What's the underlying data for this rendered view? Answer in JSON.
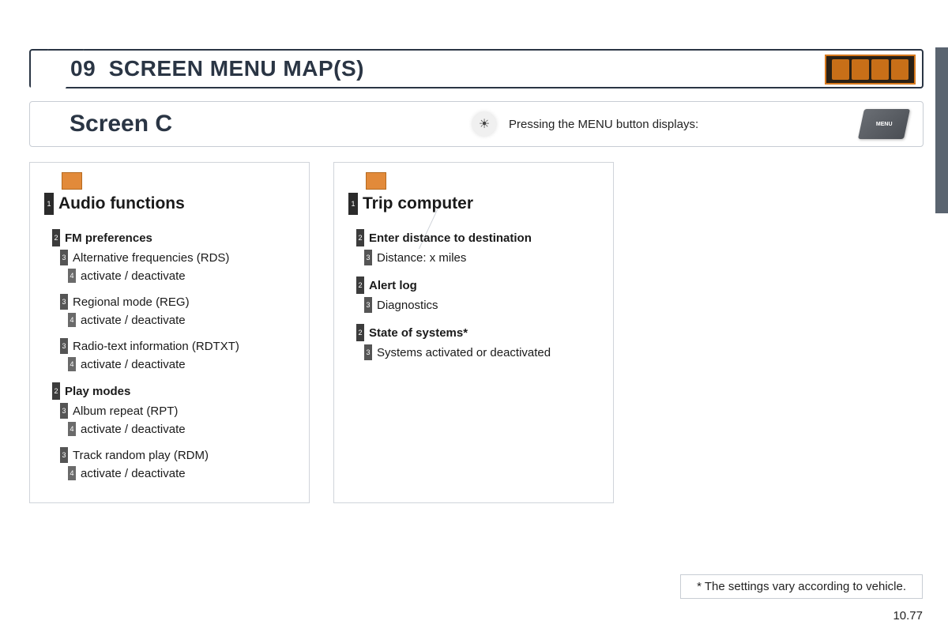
{
  "header": {
    "section_number": "09",
    "section_title": "SCREEN MENU MAP(S)"
  },
  "subtitle": {
    "screen_label": "Screen C",
    "hint": "Pressing the MENU button displays:",
    "key_label": "MENU"
  },
  "columns": [
    {
      "title": "Audio functions",
      "rows": [
        {
          "level": 2,
          "text": "FM preferences"
        },
        {
          "level": 3,
          "text": "Alternative frequencies (RDS)"
        },
        {
          "level": 4,
          "text": "activate / deactivate"
        },
        {
          "level": 3,
          "text": "Regional mode (REG)"
        },
        {
          "level": 4,
          "text": "activate / deactivate"
        },
        {
          "level": 3,
          "text": "Radio-text information (RDTXT)"
        },
        {
          "level": 4,
          "text": "activate / deactivate"
        },
        {
          "level": 2,
          "text": "Play modes"
        },
        {
          "level": 3,
          "text": "Album repeat (RPT)"
        },
        {
          "level": 4,
          "text": "activate / deactivate"
        },
        {
          "level": 3,
          "text": "Track random play (RDM)"
        },
        {
          "level": 4,
          "text": "activate / deactivate"
        }
      ]
    },
    {
      "title": "Trip computer",
      "rows": [
        {
          "level": 2,
          "text": "Enter distance to destination"
        },
        {
          "level": 3,
          "text": "Distance: x miles"
        },
        {
          "level": 2,
          "text": "Alert log"
        },
        {
          "level": 3,
          "text": "Diagnostics"
        },
        {
          "level": 2,
          "text": "State of systems*"
        },
        {
          "level": 3,
          "text": "Systems activated or deactivated"
        }
      ]
    }
  ],
  "footnote": "* The settings vary according to vehicle.",
  "page_number": "10.77"
}
